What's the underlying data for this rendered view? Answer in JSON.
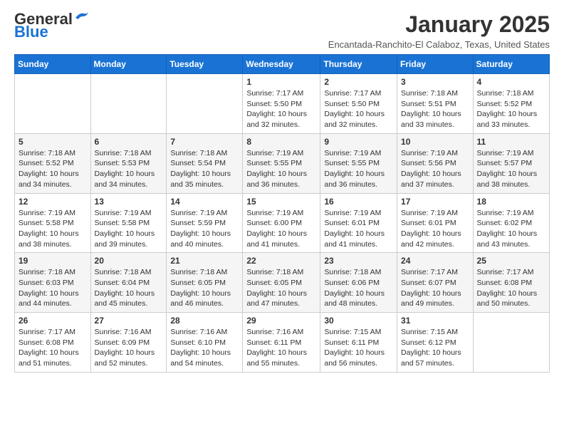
{
  "logo": {
    "general": "General",
    "blue": "Blue"
  },
  "header": {
    "title": "January 2025",
    "subtitle": "Encantada-Ranchito-El Calaboz, Texas, United States"
  },
  "weekdays": [
    "Sunday",
    "Monday",
    "Tuesday",
    "Wednesday",
    "Thursday",
    "Friday",
    "Saturday"
  ],
  "weeks": [
    [
      {
        "day": "",
        "info": ""
      },
      {
        "day": "",
        "info": ""
      },
      {
        "day": "",
        "info": ""
      },
      {
        "day": "1",
        "info": "Sunrise: 7:17 AM\nSunset: 5:50 PM\nDaylight: 10 hours\nand 32 minutes."
      },
      {
        "day": "2",
        "info": "Sunrise: 7:17 AM\nSunset: 5:50 PM\nDaylight: 10 hours\nand 32 minutes."
      },
      {
        "day": "3",
        "info": "Sunrise: 7:18 AM\nSunset: 5:51 PM\nDaylight: 10 hours\nand 33 minutes."
      },
      {
        "day": "4",
        "info": "Sunrise: 7:18 AM\nSunset: 5:52 PM\nDaylight: 10 hours\nand 33 minutes."
      }
    ],
    [
      {
        "day": "5",
        "info": "Sunrise: 7:18 AM\nSunset: 5:52 PM\nDaylight: 10 hours\nand 34 minutes."
      },
      {
        "day": "6",
        "info": "Sunrise: 7:18 AM\nSunset: 5:53 PM\nDaylight: 10 hours\nand 34 minutes."
      },
      {
        "day": "7",
        "info": "Sunrise: 7:18 AM\nSunset: 5:54 PM\nDaylight: 10 hours\nand 35 minutes."
      },
      {
        "day": "8",
        "info": "Sunrise: 7:19 AM\nSunset: 5:55 PM\nDaylight: 10 hours\nand 36 minutes."
      },
      {
        "day": "9",
        "info": "Sunrise: 7:19 AM\nSunset: 5:55 PM\nDaylight: 10 hours\nand 36 minutes."
      },
      {
        "day": "10",
        "info": "Sunrise: 7:19 AM\nSunset: 5:56 PM\nDaylight: 10 hours\nand 37 minutes."
      },
      {
        "day": "11",
        "info": "Sunrise: 7:19 AM\nSunset: 5:57 PM\nDaylight: 10 hours\nand 38 minutes."
      }
    ],
    [
      {
        "day": "12",
        "info": "Sunrise: 7:19 AM\nSunset: 5:58 PM\nDaylight: 10 hours\nand 38 minutes."
      },
      {
        "day": "13",
        "info": "Sunrise: 7:19 AM\nSunset: 5:58 PM\nDaylight: 10 hours\nand 39 minutes."
      },
      {
        "day": "14",
        "info": "Sunrise: 7:19 AM\nSunset: 5:59 PM\nDaylight: 10 hours\nand 40 minutes."
      },
      {
        "day": "15",
        "info": "Sunrise: 7:19 AM\nSunset: 6:00 PM\nDaylight: 10 hours\nand 41 minutes."
      },
      {
        "day": "16",
        "info": "Sunrise: 7:19 AM\nSunset: 6:01 PM\nDaylight: 10 hours\nand 41 minutes."
      },
      {
        "day": "17",
        "info": "Sunrise: 7:19 AM\nSunset: 6:01 PM\nDaylight: 10 hours\nand 42 minutes."
      },
      {
        "day": "18",
        "info": "Sunrise: 7:19 AM\nSunset: 6:02 PM\nDaylight: 10 hours\nand 43 minutes."
      }
    ],
    [
      {
        "day": "19",
        "info": "Sunrise: 7:18 AM\nSunset: 6:03 PM\nDaylight: 10 hours\nand 44 minutes."
      },
      {
        "day": "20",
        "info": "Sunrise: 7:18 AM\nSunset: 6:04 PM\nDaylight: 10 hours\nand 45 minutes."
      },
      {
        "day": "21",
        "info": "Sunrise: 7:18 AM\nSunset: 6:05 PM\nDaylight: 10 hours\nand 46 minutes."
      },
      {
        "day": "22",
        "info": "Sunrise: 7:18 AM\nSunset: 6:05 PM\nDaylight: 10 hours\nand 47 minutes."
      },
      {
        "day": "23",
        "info": "Sunrise: 7:18 AM\nSunset: 6:06 PM\nDaylight: 10 hours\nand 48 minutes."
      },
      {
        "day": "24",
        "info": "Sunrise: 7:17 AM\nSunset: 6:07 PM\nDaylight: 10 hours\nand 49 minutes."
      },
      {
        "day": "25",
        "info": "Sunrise: 7:17 AM\nSunset: 6:08 PM\nDaylight: 10 hours\nand 50 minutes."
      }
    ],
    [
      {
        "day": "26",
        "info": "Sunrise: 7:17 AM\nSunset: 6:08 PM\nDaylight: 10 hours\nand 51 minutes."
      },
      {
        "day": "27",
        "info": "Sunrise: 7:16 AM\nSunset: 6:09 PM\nDaylight: 10 hours\nand 52 minutes."
      },
      {
        "day": "28",
        "info": "Sunrise: 7:16 AM\nSunset: 6:10 PM\nDaylight: 10 hours\nand 54 minutes."
      },
      {
        "day": "29",
        "info": "Sunrise: 7:16 AM\nSunset: 6:11 PM\nDaylight: 10 hours\nand 55 minutes."
      },
      {
        "day": "30",
        "info": "Sunrise: 7:15 AM\nSunset: 6:11 PM\nDaylight: 10 hours\nand 56 minutes."
      },
      {
        "day": "31",
        "info": "Sunrise: 7:15 AM\nSunset: 6:12 PM\nDaylight: 10 hours\nand 57 minutes."
      },
      {
        "day": "",
        "info": ""
      }
    ]
  ]
}
